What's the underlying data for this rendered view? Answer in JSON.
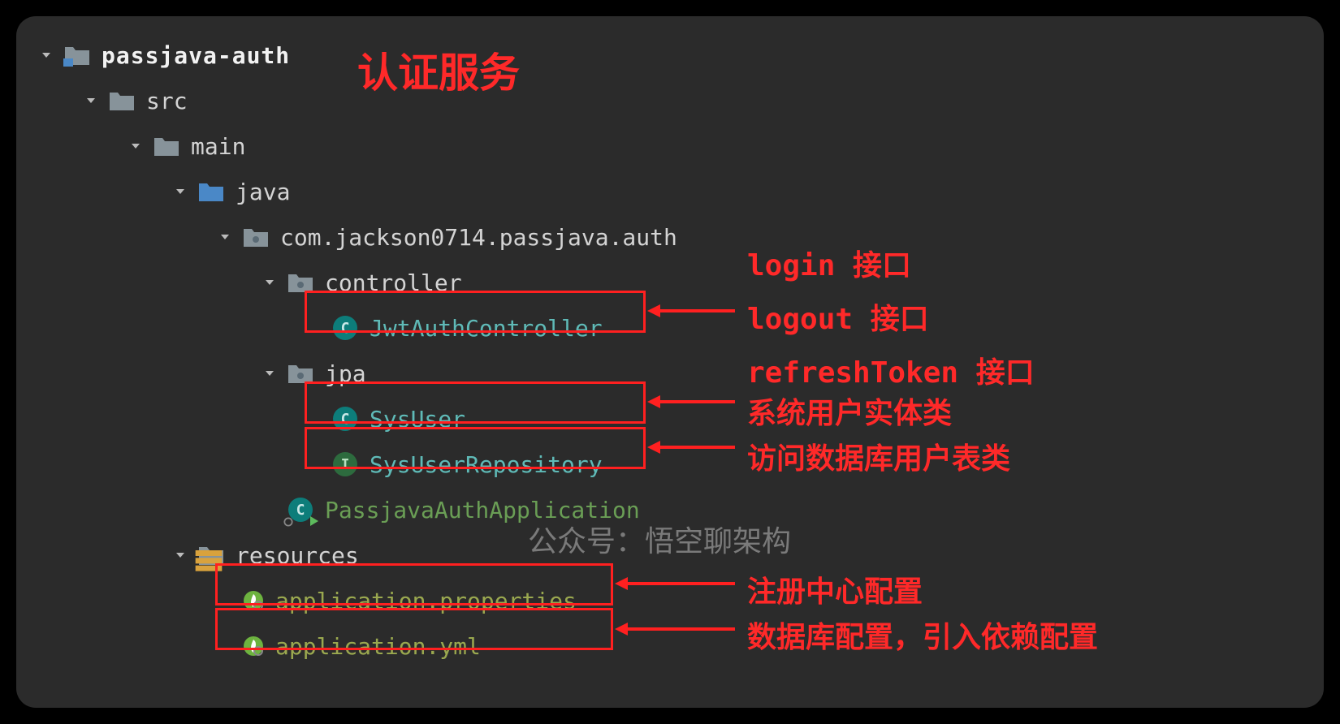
{
  "tree": {
    "root": "passjava-auth",
    "src": "src",
    "main": "main",
    "java": "java",
    "package": "com.jackson0714.passjava.auth",
    "controller": "controller",
    "jwtAuthController": "JwtAuthController",
    "jpa": "jpa",
    "sysUser": "SysUser",
    "sysUserRepository": "SysUserRepository",
    "appClass": "PassjavaAuthApplication",
    "resources": "resources",
    "appProps": "application.properties",
    "appYml": "application.yml"
  },
  "annotations": {
    "title": "认证服务",
    "login": "login 接口",
    "logout": "logout 接口",
    "refreshToken": "refreshToken 接口",
    "sysUser": "系统用户实体类",
    "sysUserRepo": "访问数据库用户表类",
    "appProps": "注册中心配置",
    "appYml": "数据库配置，引入依赖配置",
    "watermark": "公众号：悟空聊架构"
  },
  "icons": {
    "classLetter": "C",
    "interfaceLetter": "I"
  }
}
